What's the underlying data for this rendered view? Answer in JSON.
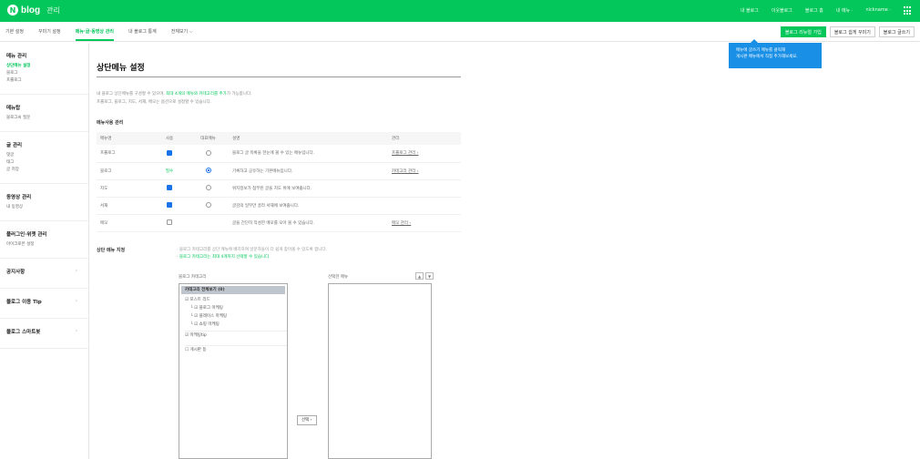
{
  "topbar": {
    "logo_letter": "N",
    "logo_text": "blog",
    "mode": "관리",
    "links": [
      "내 블로그",
      "이웃블로그",
      "블로그 홈",
      "내 메뉴 ·",
      "nickname ·"
    ]
  },
  "subtabs": [
    "기본 설정",
    "꾸미기 설정",
    "메뉴·글·동영상 관리",
    "내 블로그 통계",
    "전체보기 ⌵"
  ],
  "subtab_active_index": 2,
  "right_buttons": [
    "블로그 리뉴얼 가입",
    "블로그 쉽게 꾸미기",
    "블로그 글쓰기"
  ],
  "tooltip": [
    "메뉴에 글쓰기 메뉴를 클릭해",
    "게시판 메뉴에서 직접 추가해보세요."
  ],
  "sidebar": [
    {
      "title": "메뉴 관리",
      "items": [
        "상단메뉴 설정",
        "블로그",
        "프롤로그"
      ],
      "selected": 0
    },
    {
      "title": "메뉴탑",
      "items": [
        "블로그씨 질문"
      ]
    },
    {
      "title": "글 관리",
      "items": [
        "댓글",
        "태그",
        "글 저장"
      ]
    },
    {
      "title": "동영상 관리",
      "items": [
        "내 동영상"
      ]
    },
    {
      "title": "플러그인·위젯 관리",
      "items": [
        "마이크로폰 설정"
      ]
    },
    {
      "title": "공지사항",
      "items": [],
      "chevron": "›"
    },
    {
      "title": "블로그 이용 Tip",
      "items": [],
      "chevron": "›"
    },
    {
      "title": "블로그 스마트봇",
      "items": [],
      "chevron": "›"
    }
  ],
  "main": {
    "title": "상단메뉴 설정",
    "desc1_a": "내 블로그 상단메뉴를 구성할 수 있으며, ",
    "desc1_b": "최대 4개의 메뉴와 카테고리를 추가",
    "desc1_c": "가 가능합니다.",
    "desc2": "프롤로그, 블로그, 지도, 서재, 메모는 옵션으로 설정할 수 있습니다.",
    "section1": "메뉴사용 관리",
    "table_headers": [
      "메뉴명",
      "사용",
      "대표메뉴",
      "설명",
      "관리"
    ],
    "rows": [
      {
        "name": "프롤로그",
        "use": "check",
        "rep": false,
        "desc": "블로그 글 목록을 한눈에 볼 수 있는 메뉴입니다.",
        "manage": "프롤로그 관리 ›"
      },
      {
        "name": "블로그",
        "use": "필수",
        "rep": true,
        "desc": "기록하고 공유하는 기본메뉴입니다.",
        "manage": "카테고리 관리 ›"
      },
      {
        "name": "지도",
        "use": "check",
        "rep": false,
        "desc": "위치정보가 첨부된 글을 지도 위에 보여줍니다.",
        "manage": ""
      },
      {
        "name": "서재",
        "use": "check",
        "rep": false,
        "desc": "글감의 일부만 골라 서재에 보여줍니다.",
        "manage": ""
      },
      {
        "name": "메모",
        "use": "empty",
        "rep": false,
        "desc": "글을 간단히 작성한 메모를 모아 볼 수 있습니다.",
        "manage": "메모 관리 ›"
      }
    ],
    "section2": "상단 메뉴 지정",
    "notes1": "· 블로그 카테고리를 상단 메뉴에 배치하여 방문자들이 더 쉽게 찾아볼 수 있도록 합니다.",
    "notes2": "· 블로그 카테고리는 최대 4개까지 선택할 수 있습니다.",
    "label_categories": "블로그 카테고리",
    "label_selected": "선택한 메뉴",
    "tree_header": "카테고리 전체보기 (0)",
    "tree": [
      {
        "label": "☑ 포스트 리드",
        "level": 0
      },
      {
        "label": "└ ☑ 블로그 마케팅",
        "level": 1
      },
      {
        "label": "└ ☑ 플레이스 마케팅",
        "level": 1
      },
      {
        "label": "└ ☑ 쇼핑 마케팅",
        "level": 1
      },
      {
        "label": "☑ 마케팅tip",
        "level": 0
      },
      {
        "label": "☐ 게시판 등",
        "level": 0
      }
    ],
    "select_button": "선택 ›",
    "up": "▲",
    "down": "▼"
  }
}
